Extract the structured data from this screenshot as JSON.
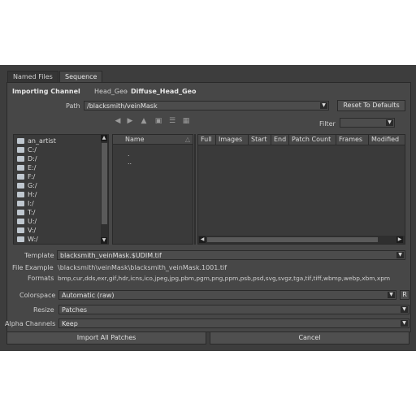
{
  "tabs": [
    {
      "label": "Named Files"
    },
    {
      "label": "Sequence"
    }
  ],
  "importing": {
    "label": "Importing Channel",
    "object": "Head_Geo",
    "separator": "-",
    "channel": "Diffuse_Head_Geo"
  },
  "path": {
    "label": "Path",
    "value": "/blacksmith/veinMask"
  },
  "reset_button": "Reset To Defaults",
  "filter": {
    "label": "Filter",
    "value": ""
  },
  "toolbar_icons": [
    "back-arrow-icon",
    "forward-arrow-icon",
    "up-arrow-icon",
    "new-folder-icon",
    "list-view-icon",
    "detail-view-icon"
  ],
  "drives": [
    "an_artist",
    "C:/",
    "D:/",
    "E:/",
    "F:/",
    "G:/",
    "H:/",
    "I:/",
    "T:/",
    "U:/",
    "V:/",
    "W:/"
  ],
  "name_column": {
    "header": "Name",
    "items": [
      ".",
      ".."
    ]
  },
  "file_table": {
    "columns": [
      "Full",
      "Images",
      "Start",
      "End",
      "Patch Count",
      "Frames",
      "Modified"
    ]
  },
  "template": {
    "label": "Template",
    "value": "blacksmith_veinMask.$UDIM.tif"
  },
  "file_example": {
    "label": "File Example",
    "value": "\\blacksmith\\veinMask\\blacksmith_veinMask.1001.tif"
  },
  "formats": {
    "label": "Formats",
    "value": "bmp,cur,dds,exr,gif,hdr,icns,ico,jpeg,jpg,pbm,pgm,png,ppm,psb,psd,svg,svgz,tga,tif,tiff,wbmp,webp,xbm,xpm"
  },
  "colorspace": {
    "label": "Colorspace",
    "value": "Automatic (raw)",
    "raw_button": "R"
  },
  "resize": {
    "label": "Resize",
    "value": "Patches"
  },
  "alpha": {
    "label": "Alpha Channels",
    "value": "Keep"
  },
  "import_button": "Import All Patches",
  "cancel_button": "Cancel"
}
